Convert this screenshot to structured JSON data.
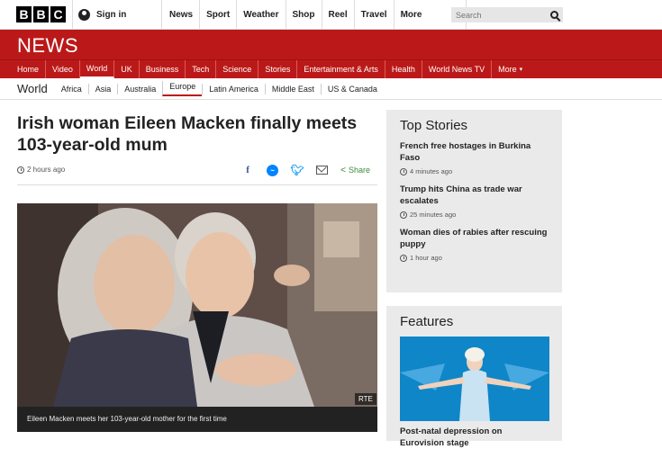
{
  "brand": {
    "logo_letters": [
      "B",
      "B",
      "C"
    ]
  },
  "account": {
    "signin_label": "Sign in",
    "icon": "user-icon"
  },
  "topnav": {
    "items": [
      "News",
      "Sport",
      "Weather",
      "Shop",
      "Reel",
      "Travel"
    ],
    "more_label": "More"
  },
  "search": {
    "placeholder": "Search",
    "icon": "search-icon"
  },
  "banner": {
    "title": "NEWS"
  },
  "sections": {
    "items": [
      "Home",
      "Video",
      "World",
      "UK",
      "Business",
      "Tech",
      "Science",
      "Stories",
      "Entertainment & Arts",
      "Health",
      "World News TV"
    ],
    "more_label": "More",
    "active": "World"
  },
  "subnav": {
    "title": "World",
    "items": [
      "Africa",
      "Asia",
      "Australia",
      "Europe",
      "Latin America",
      "Middle East",
      "US & Canada"
    ],
    "active": "Europe"
  },
  "article": {
    "headline": "Irish woman Eileen Macken finally meets 103-year-old mum",
    "time": "2 hours ago",
    "share_label": "Share",
    "photo_credit": "RTE",
    "caption": "Eileen Macken meets her 103-year-old mother for the first time"
  },
  "top_stories": {
    "title": "Top Stories",
    "stories": [
      {
        "title": "French free hostages in Burkina Faso",
        "time": "4 minutes ago"
      },
      {
        "title": "Trump hits China as trade war escalates",
        "time": "25 minutes ago"
      },
      {
        "title": "Woman dies of rabies after rescuing puppy",
        "time": "1 hour ago"
      }
    ]
  },
  "features": {
    "title": "Features",
    "items": [
      {
        "title": "Post-natal depression on Eurovision stage"
      }
    ]
  },
  "colors": {
    "brand_red": "#bb1919",
    "share_green": "#3c8b3c",
    "panel_grey": "#eaeaea"
  }
}
